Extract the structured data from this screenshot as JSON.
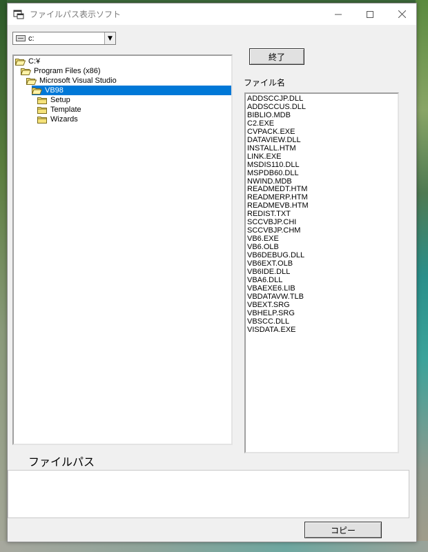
{
  "window": {
    "title": "ファイルパス表示ソフト"
  },
  "drive": {
    "selected": "c:"
  },
  "directories": [
    {
      "label": "C:¥",
      "depth": 0,
      "open": true,
      "selected": false
    },
    {
      "label": "Program Files (x86)",
      "depth": 1,
      "open": true,
      "selected": false
    },
    {
      "label": "Microsoft Visual Studio",
      "depth": 2,
      "open": true,
      "selected": false
    },
    {
      "label": "VB98",
      "depth": 3,
      "open": true,
      "selected": true
    },
    {
      "label": "Setup",
      "depth": 4,
      "open": false,
      "selected": false
    },
    {
      "label": "Template",
      "depth": 4,
      "open": false,
      "selected": false
    },
    {
      "label": "Wizards",
      "depth": 4,
      "open": false,
      "selected": false
    }
  ],
  "exit_button": {
    "label": "終了"
  },
  "file_list": {
    "label": "ファイル名",
    "items": [
      "ADDSCCJP.DLL",
      "ADDSCCUS.DLL",
      "BIBLIO.MDB",
      "C2.EXE",
      "CVPACK.EXE",
      "DATAVIEW.DLL",
      "INSTALL.HTM",
      "LINK.EXE",
      "MSDIS110.DLL",
      "MSPDB60.DLL",
      "NWIND.MDB",
      "READMEDT.HTM",
      "READMERP.HTM",
      "READMEVB.HTM",
      "REDIST.TXT",
      "SCCVBJP.CHI",
      "SCCVBJP.CHM",
      "VB6.EXE",
      "VB6.OLB",
      "VB6DEBUG.DLL",
      "VB6EXT.OLB",
      "VB6IDE.DLL",
      "VBA6.DLL",
      "VBAEXE6.LIB",
      "VBDATAVW.TLB",
      "VBEXT.SRG",
      "VBHELP.SRG",
      "VBSCC.DLL",
      "VISDATA.EXE"
    ]
  },
  "file_path": {
    "label": "ファイルパス",
    "value": ""
  },
  "copy_button": {
    "label": "コピー"
  },
  "colors": {
    "selection": "#0078d7",
    "window_bg": "#f0f0f0",
    "folder": "#f5e27a"
  },
  "icons": {
    "app": "window-app-icon",
    "minimize": "minimize-icon",
    "maximize": "maximize-icon",
    "close": "close-icon",
    "drive": "drive-icon",
    "folder": "folder-icon",
    "folder_open": "folder-open-icon"
  }
}
